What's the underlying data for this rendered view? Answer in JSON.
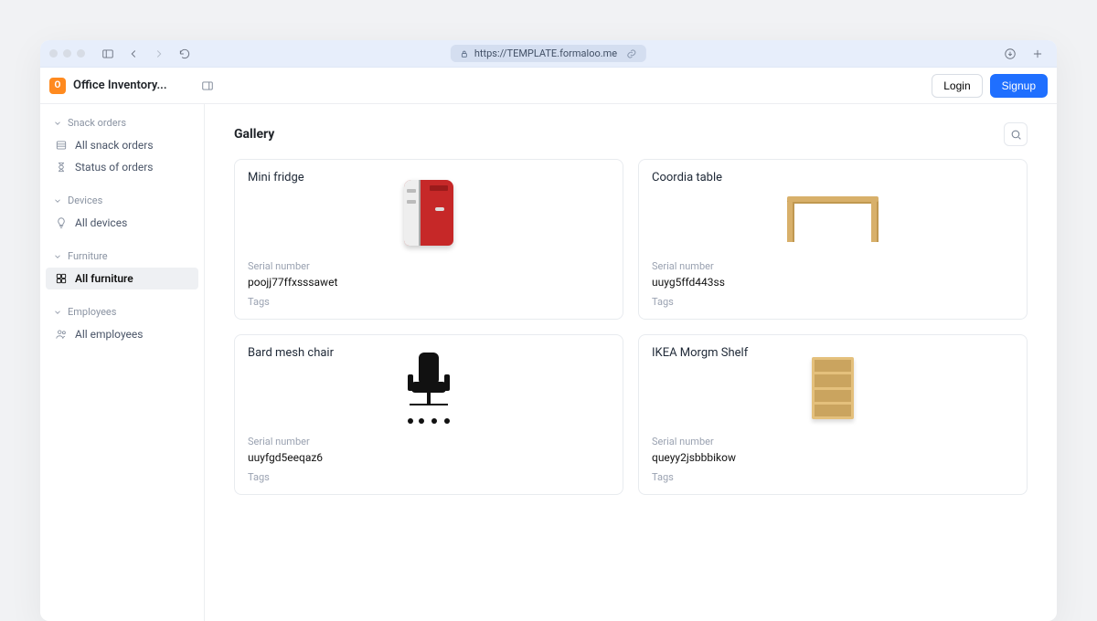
{
  "chrome": {
    "url": "https://TEMPLATE.formaloo.me"
  },
  "header": {
    "app_title": "Office Inventory...",
    "logo_letter": "O",
    "login": "Login",
    "signup": "Signup"
  },
  "sidebar": {
    "groups": [
      {
        "label": "Snack orders",
        "items": [
          {
            "label": "All snack orders",
            "icon": "list"
          },
          {
            "label": "Status of orders",
            "icon": "hourglass"
          }
        ]
      },
      {
        "label": "Devices",
        "items": [
          {
            "label": "All devices",
            "icon": "bulb"
          }
        ]
      },
      {
        "label": "Furniture",
        "items": [
          {
            "label": "All furniture",
            "icon": "grid",
            "active": true
          }
        ]
      },
      {
        "label": "Employees",
        "items": [
          {
            "label": "All employees",
            "icon": "users"
          }
        ]
      }
    ]
  },
  "main": {
    "title": "Gallery",
    "serial_label": "Serial number",
    "tags_label": "Tags",
    "cards": [
      {
        "title": "Mini fridge",
        "serial": "poojj77ffxsssawet",
        "img": "fridge"
      },
      {
        "title": "Coordia table",
        "serial": "uuyg5ffd443ss",
        "img": "table"
      },
      {
        "title": "Bard mesh chair",
        "serial": "uuyfgd5eeqaz6",
        "img": "chair"
      },
      {
        "title": "IKEA Morgm Shelf",
        "serial": "queyy2jsbbbikow",
        "img": "shelf"
      }
    ]
  }
}
